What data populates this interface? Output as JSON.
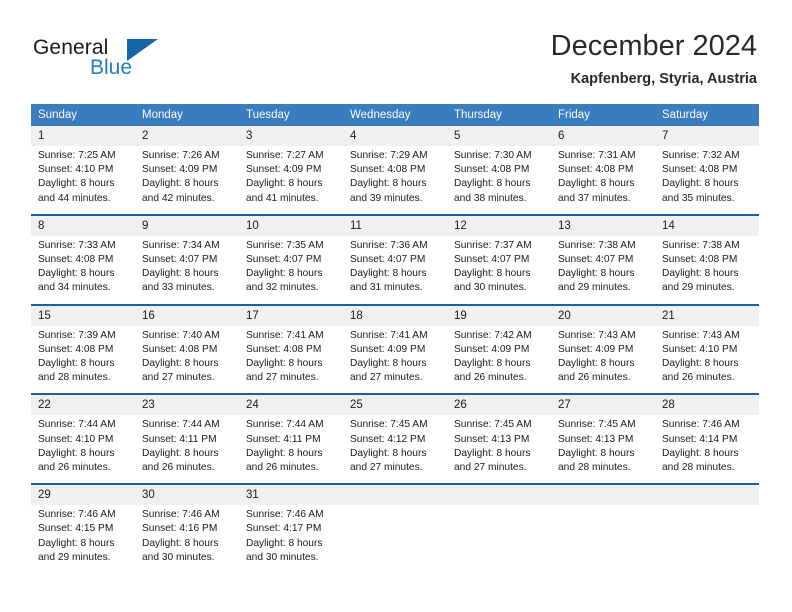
{
  "logo": {
    "word1": "General",
    "word2": "Blue",
    "accent_color": "#1565a8",
    "text_color": "#1f7fc4"
  },
  "header": {
    "title": "December 2024",
    "location": "Kapfenberg, Styria, Austria"
  },
  "calendar": {
    "header_bg": "#3a7dbf",
    "daynum_bg": "#f0f0f0",
    "rule_color": "#1f5fa0",
    "weekday_headers": [
      "Sunday",
      "Monday",
      "Tuesday",
      "Wednesday",
      "Thursday",
      "Friday",
      "Saturday"
    ],
    "weeks": [
      [
        {
          "day": "1",
          "sunrise": "Sunrise: 7:25 AM",
          "sunset": "Sunset: 4:10 PM",
          "daylight1": "Daylight: 8 hours",
          "daylight2": "and 44 minutes."
        },
        {
          "day": "2",
          "sunrise": "Sunrise: 7:26 AM",
          "sunset": "Sunset: 4:09 PM",
          "daylight1": "Daylight: 8 hours",
          "daylight2": "and 42 minutes."
        },
        {
          "day": "3",
          "sunrise": "Sunrise: 7:27 AM",
          "sunset": "Sunset: 4:09 PM",
          "daylight1": "Daylight: 8 hours",
          "daylight2": "and 41 minutes."
        },
        {
          "day": "4",
          "sunrise": "Sunrise: 7:29 AM",
          "sunset": "Sunset: 4:08 PM",
          "daylight1": "Daylight: 8 hours",
          "daylight2": "and 39 minutes."
        },
        {
          "day": "5",
          "sunrise": "Sunrise: 7:30 AM",
          "sunset": "Sunset: 4:08 PM",
          "daylight1": "Daylight: 8 hours",
          "daylight2": "and 38 minutes."
        },
        {
          "day": "6",
          "sunrise": "Sunrise: 7:31 AM",
          "sunset": "Sunset: 4:08 PM",
          "daylight1": "Daylight: 8 hours",
          "daylight2": "and 37 minutes."
        },
        {
          "day": "7",
          "sunrise": "Sunrise: 7:32 AM",
          "sunset": "Sunset: 4:08 PM",
          "daylight1": "Daylight: 8 hours",
          "daylight2": "and 35 minutes."
        }
      ],
      [
        {
          "day": "8",
          "sunrise": "Sunrise: 7:33 AM",
          "sunset": "Sunset: 4:08 PM",
          "daylight1": "Daylight: 8 hours",
          "daylight2": "and 34 minutes."
        },
        {
          "day": "9",
          "sunrise": "Sunrise: 7:34 AM",
          "sunset": "Sunset: 4:07 PM",
          "daylight1": "Daylight: 8 hours",
          "daylight2": "and 33 minutes."
        },
        {
          "day": "10",
          "sunrise": "Sunrise: 7:35 AM",
          "sunset": "Sunset: 4:07 PM",
          "daylight1": "Daylight: 8 hours",
          "daylight2": "and 32 minutes."
        },
        {
          "day": "11",
          "sunrise": "Sunrise: 7:36 AM",
          "sunset": "Sunset: 4:07 PM",
          "daylight1": "Daylight: 8 hours",
          "daylight2": "and 31 minutes."
        },
        {
          "day": "12",
          "sunrise": "Sunrise: 7:37 AM",
          "sunset": "Sunset: 4:07 PM",
          "daylight1": "Daylight: 8 hours",
          "daylight2": "and 30 minutes."
        },
        {
          "day": "13",
          "sunrise": "Sunrise: 7:38 AM",
          "sunset": "Sunset: 4:07 PM",
          "daylight1": "Daylight: 8 hours",
          "daylight2": "and 29 minutes."
        },
        {
          "day": "14",
          "sunrise": "Sunrise: 7:38 AM",
          "sunset": "Sunset: 4:08 PM",
          "daylight1": "Daylight: 8 hours",
          "daylight2": "and 29 minutes."
        }
      ],
      [
        {
          "day": "15",
          "sunrise": "Sunrise: 7:39 AM",
          "sunset": "Sunset: 4:08 PM",
          "daylight1": "Daylight: 8 hours",
          "daylight2": "and 28 minutes."
        },
        {
          "day": "16",
          "sunrise": "Sunrise: 7:40 AM",
          "sunset": "Sunset: 4:08 PM",
          "daylight1": "Daylight: 8 hours",
          "daylight2": "and 27 minutes."
        },
        {
          "day": "17",
          "sunrise": "Sunrise: 7:41 AM",
          "sunset": "Sunset: 4:08 PM",
          "daylight1": "Daylight: 8 hours",
          "daylight2": "and 27 minutes."
        },
        {
          "day": "18",
          "sunrise": "Sunrise: 7:41 AM",
          "sunset": "Sunset: 4:09 PM",
          "daylight1": "Daylight: 8 hours",
          "daylight2": "and 27 minutes."
        },
        {
          "day": "19",
          "sunrise": "Sunrise: 7:42 AM",
          "sunset": "Sunset: 4:09 PM",
          "daylight1": "Daylight: 8 hours",
          "daylight2": "and 26 minutes."
        },
        {
          "day": "20",
          "sunrise": "Sunrise: 7:43 AM",
          "sunset": "Sunset: 4:09 PM",
          "daylight1": "Daylight: 8 hours",
          "daylight2": "and 26 minutes."
        },
        {
          "day": "21",
          "sunrise": "Sunrise: 7:43 AM",
          "sunset": "Sunset: 4:10 PM",
          "daylight1": "Daylight: 8 hours",
          "daylight2": "and 26 minutes."
        }
      ],
      [
        {
          "day": "22",
          "sunrise": "Sunrise: 7:44 AM",
          "sunset": "Sunset: 4:10 PM",
          "daylight1": "Daylight: 8 hours",
          "daylight2": "and 26 minutes."
        },
        {
          "day": "23",
          "sunrise": "Sunrise: 7:44 AM",
          "sunset": "Sunset: 4:11 PM",
          "daylight1": "Daylight: 8 hours",
          "daylight2": "and 26 minutes."
        },
        {
          "day": "24",
          "sunrise": "Sunrise: 7:44 AM",
          "sunset": "Sunset: 4:11 PM",
          "daylight1": "Daylight: 8 hours",
          "daylight2": "and 26 minutes."
        },
        {
          "day": "25",
          "sunrise": "Sunrise: 7:45 AM",
          "sunset": "Sunset: 4:12 PM",
          "daylight1": "Daylight: 8 hours",
          "daylight2": "and 27 minutes."
        },
        {
          "day": "26",
          "sunrise": "Sunrise: 7:45 AM",
          "sunset": "Sunset: 4:13 PM",
          "daylight1": "Daylight: 8 hours",
          "daylight2": "and 27 minutes."
        },
        {
          "day": "27",
          "sunrise": "Sunrise: 7:45 AM",
          "sunset": "Sunset: 4:13 PM",
          "daylight1": "Daylight: 8 hours",
          "daylight2": "and 28 minutes."
        },
        {
          "day": "28",
          "sunrise": "Sunrise: 7:46 AM",
          "sunset": "Sunset: 4:14 PM",
          "daylight1": "Daylight: 8 hours",
          "daylight2": "and 28 minutes."
        }
      ],
      [
        {
          "day": "29",
          "sunrise": "Sunrise: 7:46 AM",
          "sunset": "Sunset: 4:15 PM",
          "daylight1": "Daylight: 8 hours",
          "daylight2": "and 29 minutes."
        },
        {
          "day": "30",
          "sunrise": "Sunrise: 7:46 AM",
          "sunset": "Sunset: 4:16 PM",
          "daylight1": "Daylight: 8 hours",
          "daylight2": "and 30 minutes."
        },
        {
          "day": "31",
          "sunrise": "Sunrise: 7:46 AM",
          "sunset": "Sunset: 4:17 PM",
          "daylight1": "Daylight: 8 hours",
          "daylight2": "and 30 minutes."
        },
        {
          "day": "",
          "sunrise": "",
          "sunset": "",
          "daylight1": "",
          "daylight2": ""
        },
        {
          "day": "",
          "sunrise": "",
          "sunset": "",
          "daylight1": "",
          "daylight2": ""
        },
        {
          "day": "",
          "sunrise": "",
          "sunset": "",
          "daylight1": "",
          "daylight2": ""
        },
        {
          "day": "",
          "sunrise": "",
          "sunset": "",
          "daylight1": "",
          "daylight2": ""
        }
      ]
    ]
  }
}
